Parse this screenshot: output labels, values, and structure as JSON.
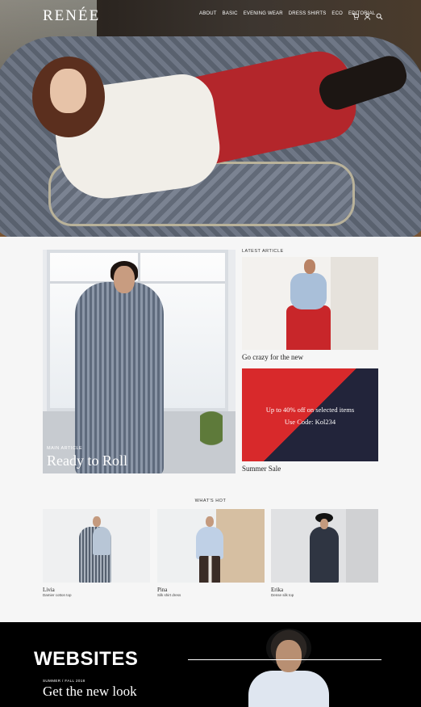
{
  "brand": "RENÉE",
  "nav": {
    "items": [
      "ABOUT",
      "BASIC",
      "EVENING WEAR",
      "DRESS SHIRTS",
      "ECO",
      "EDITORIAL"
    ],
    "icons": [
      "cart-icon",
      "user-icon",
      "search-icon"
    ]
  },
  "main_article": {
    "kicker": "MAIN ARTICLE",
    "title": "Ready to Roll"
  },
  "latest": {
    "label": "LATEST ARTICLE",
    "card1_caption": "Go crazy for the new",
    "card2_line1": "Up to 40% off on selected items",
    "card2_line2": "Use Code: Kol234",
    "card2_caption": "Summer Sale"
  },
  "whats_hot": {
    "label": "WHAT'S HOT",
    "items": [
      {
        "name": "Livia",
        "desc": "Damier cotton top"
      },
      {
        "name": "Pina",
        "desc": "Silk shirt dress"
      },
      {
        "name": "Erika",
        "desc": "Dense silk top"
      }
    ]
  },
  "banner": {
    "title": "WEBSITES",
    "kicker": "SUMMER / FALL 2018",
    "cta": "Get the new look"
  },
  "colors": {
    "accent_red": "#d8292b",
    "navy": "#22243a",
    "banner_bg": "#000000"
  }
}
